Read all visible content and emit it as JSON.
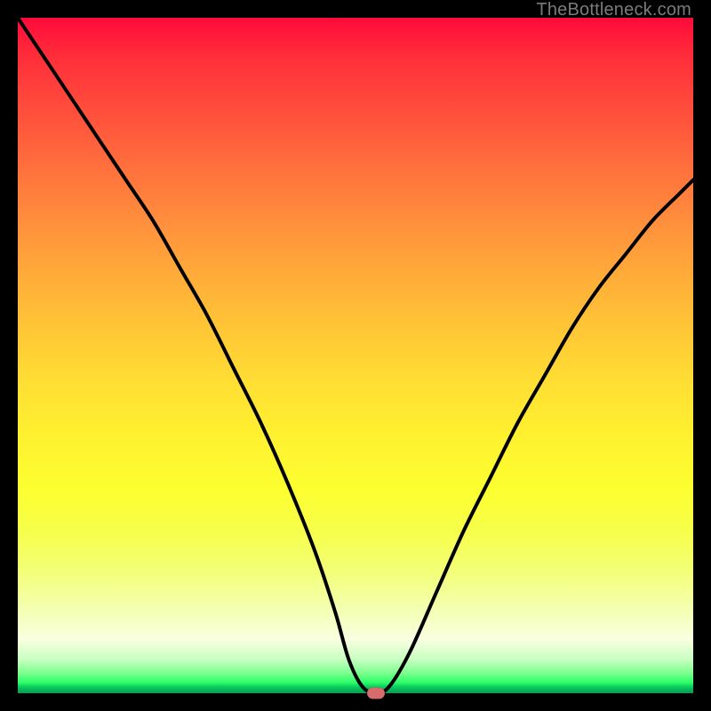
{
  "attribution": "TheBottleneck.com",
  "colors": {
    "frame": "#000000",
    "curve": "#000000",
    "marker": "#d86b6b"
  },
  "chart_data": {
    "type": "line",
    "title": "",
    "xlabel": "",
    "ylabel": "",
    "xlim": [
      0,
      100
    ],
    "ylim": [
      0,
      100
    ],
    "series": [
      {
        "name": "bottleneck-curve",
        "x": [
          0,
          4,
          8,
          12,
          16,
          20,
          24,
          28,
          32,
          36,
          40,
          44,
          47,
          49,
          51,
          53,
          55,
          58,
          62,
          66,
          70,
          74,
          78,
          82,
          86,
          90,
          94,
          98,
          100
        ],
        "values": [
          100,
          94,
          88,
          82,
          76,
          70,
          63,
          56,
          48,
          40,
          31,
          21,
          12,
          5,
          1,
          0,
          1,
          6,
          15,
          24,
          32,
          40,
          47,
          54,
          60,
          65,
          70,
          74,
          76
        ]
      }
    ],
    "marker": {
      "x": 53,
      "y": 0,
      "label": "optimal-point"
    },
    "background_gradient": [
      {
        "pos": 0,
        "color": "#ff0a3a"
      },
      {
        "pos": 50,
        "color": "#ffd834"
      },
      {
        "pos": 90,
        "color": "#f8ffd8"
      },
      {
        "pos": 100,
        "color": "#08a851"
      }
    ]
  }
}
